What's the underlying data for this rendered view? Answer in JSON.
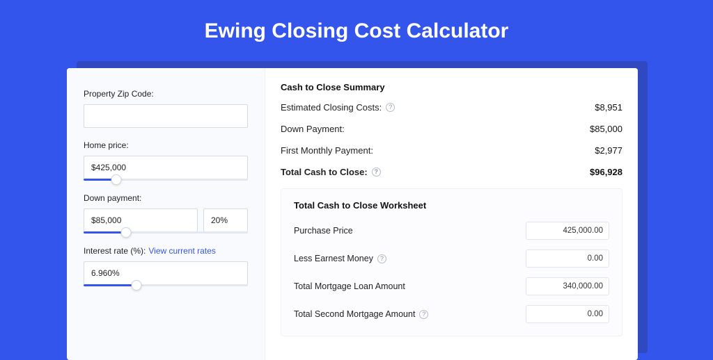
{
  "page": {
    "title": "Ewing Closing Cost Calculator"
  },
  "form": {
    "zip_label": "Property Zip Code:",
    "zip_value": "",
    "home_price_label": "Home price:",
    "home_price_value": "$425,000",
    "home_price_slider_pct": 20,
    "down_payment_label": "Down payment:",
    "down_payment_value": "$85,000",
    "down_payment_pct": "20%",
    "down_payment_slider_pct": 26,
    "rate_label": "Interest rate (%):",
    "rate_link": "View current rates",
    "rate_value": "6.960%",
    "rate_slider_pct": 32
  },
  "summary": {
    "title": "Cash to Close Summary",
    "rows": [
      {
        "label": "Estimated Closing Costs:",
        "value": "$8,951",
        "help": true
      },
      {
        "label": "Down Payment:",
        "value": "$85,000",
        "help": false
      },
      {
        "label": "First Monthly Payment:",
        "value": "$2,977",
        "help": false
      }
    ],
    "total_label": "Total Cash to Close:",
    "total_value": "$96,928"
  },
  "worksheet": {
    "title": "Total Cash to Close Worksheet",
    "rows": [
      {
        "label": "Purchase Price",
        "value": "425,000.00",
        "help": false
      },
      {
        "label": "Less Earnest Money",
        "value": "0.00",
        "help": true
      },
      {
        "label": "Total Mortgage Loan Amount",
        "value": "340,000.00",
        "help": false
      },
      {
        "label": "Total Second Mortgage Amount",
        "value": "0.00",
        "help": true
      }
    ]
  },
  "icons": {
    "help_glyph": "?"
  }
}
